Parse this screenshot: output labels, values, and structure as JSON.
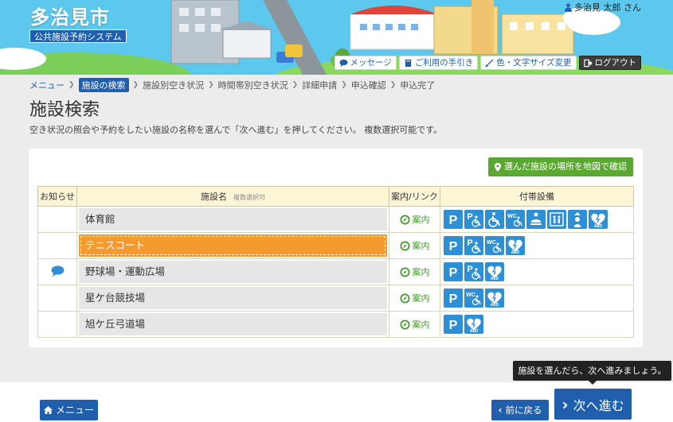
{
  "header": {
    "city_name": "多治見市",
    "system_name": "公共施設予約システム",
    "user": "多治見 太郎 さん",
    "buttons": {
      "message": "メッセージ",
      "guide": "ご利用の手引き",
      "display": "色・文字サイズ変更",
      "logout": "ログアウト"
    }
  },
  "breadcrumb": {
    "items": [
      "メニュー",
      "施設の検索",
      "施設別空き状況",
      "時間帯別空き状況",
      "詳細申請",
      "申込確認",
      "申込完了"
    ],
    "current_index": 1
  },
  "page": {
    "title": "施設検索",
    "instruction": "空き状況の照会や予約をしたい施設の名称を選んで「次へ進む」を押してください。 複数選択可能です。"
  },
  "map_button": "選んだ施設の場所を地図で確認",
  "table": {
    "headers": {
      "notice": "お知らせ",
      "name": "施設名",
      "name_sub": "複数選択可",
      "link": "案内/リンク",
      "equipment": "付帯設備"
    },
    "rows": [
      {
        "name": "体育館",
        "link": "案内",
        "selected": false,
        "notice": false,
        "equipment": [
          "parking",
          "accessible-parking",
          "wheelchair",
          "accessible-toilet",
          "baby-care",
          "elevator",
          "nursing-room",
          "aed"
        ]
      },
      {
        "name": "テニスコート",
        "link": "案内",
        "selected": true,
        "notice": false,
        "equipment": [
          "parking",
          "accessible-parking",
          "accessible-toilet",
          "aed"
        ]
      },
      {
        "name": "野球場・運動広場",
        "link": "案内",
        "selected": false,
        "notice": true,
        "equipment": [
          "parking",
          "accessible-parking",
          "aed"
        ]
      },
      {
        "name": "星ケ台競技場",
        "link": "案内",
        "selected": false,
        "notice": false,
        "equipment": [
          "parking",
          "accessible-toilet",
          "aed"
        ]
      },
      {
        "name": "旭ケ丘弓道場",
        "link": "案内",
        "selected": false,
        "notice": false,
        "equipment": [
          "parking",
          "aed"
        ]
      }
    ]
  },
  "footer": {
    "menu": "メニュー",
    "back": "前に戻る",
    "next": "次へ進む",
    "tooltip": "施設を選んだら、次へ進みましょう。"
  },
  "colors": {
    "header_sky": "#5cc8ee",
    "primary": "#1f5fae",
    "selected": "#f59a2e",
    "map_button": "#5ba830",
    "equipment": "#2d8fd6",
    "table_header": "#fcf6d7"
  }
}
